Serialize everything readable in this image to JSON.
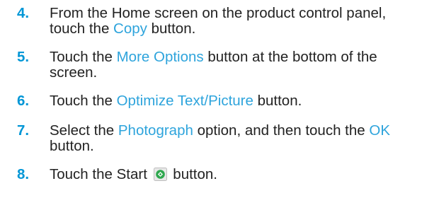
{
  "steps": [
    {
      "number": "4.",
      "before": "From the Home screen on the product control panel, touch the ",
      "ui": "Copy",
      "after": " button."
    },
    {
      "number": "5.",
      "before": "Touch the ",
      "ui": "More Options",
      "after": " button at the bottom of the screen."
    },
    {
      "number": "6.",
      "before": "Touch the ",
      "ui": "Optimize Text/Picture",
      "after": " button."
    },
    {
      "number": "7.",
      "before": "Select the ",
      "ui": "Photograph",
      "middle": " option, and then touch the ",
      "ui2": "OK",
      "after": " button."
    },
    {
      "number": "8.",
      "before": "Touch the Start ",
      "icon": "start-button-icon",
      "after": " button."
    }
  ],
  "colors": {
    "step_number": "#0096d6",
    "ui_term": "#2ea4dc",
    "body_text": "#222222",
    "start_icon_green": "#2fa84f"
  }
}
